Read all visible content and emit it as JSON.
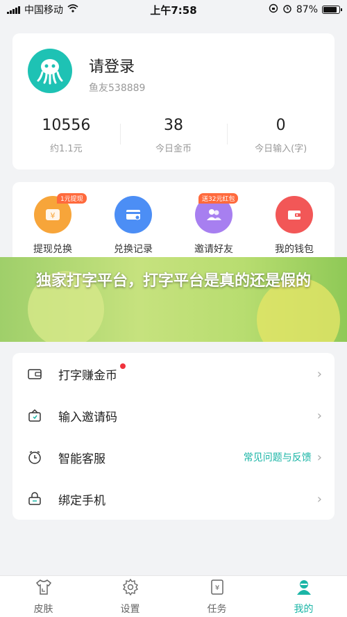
{
  "status_bar": {
    "carrier": "中国移动",
    "time": "上午7:58",
    "battery": "87%",
    "battery_level": 0.87
  },
  "profile": {
    "name": "请登录",
    "id": "鱼友538889",
    "stats": [
      {
        "value": "10556",
        "label": "约1.1元"
      },
      {
        "value": "38",
        "label": "今日金币"
      },
      {
        "value": "0",
        "label": "今日输入(字)"
      }
    ]
  },
  "shortcuts": [
    {
      "label": "提现兑换",
      "badge": "1元提现",
      "icon": "withdraw-icon",
      "color": "#f7a53a"
    },
    {
      "label": "兑换记录",
      "badge": "",
      "icon": "card-icon",
      "color": "#4c8ef5"
    },
    {
      "label": "邀请好友",
      "badge": "送32元红包",
      "icon": "people-icon",
      "color": "#a77ff0"
    },
    {
      "label": "我的钱包",
      "badge": "",
      "icon": "wallet-icon",
      "color": "#f25757"
    }
  ],
  "banner": {
    "title": "独家打字平台，打字平台是真的还是假的"
  },
  "menu": [
    {
      "label": "打字赚金币",
      "extra": "",
      "icon": "wallet-outline-icon",
      "dot": true
    },
    {
      "label": "输入邀请码",
      "extra": "",
      "icon": "gift-icon",
      "dot": false
    },
    {
      "label": "智能客服",
      "extra": "常见问题与反馈",
      "icon": "clock-icon",
      "dot": false
    },
    {
      "label": "绑定手机",
      "extra": "",
      "icon": "lock-icon",
      "dot": false
    }
  ],
  "tabbar": [
    {
      "label": "皮肤",
      "icon": "shirt-icon",
      "active": false
    },
    {
      "label": "设置",
      "icon": "gear-icon",
      "active": false
    },
    {
      "label": "任务",
      "icon": "task-icon",
      "active": false
    },
    {
      "label": "我的",
      "icon": "user-icon",
      "active": true
    }
  ],
  "colors": {
    "accent": "#1ab5a6",
    "background": "#f2f3f5"
  }
}
